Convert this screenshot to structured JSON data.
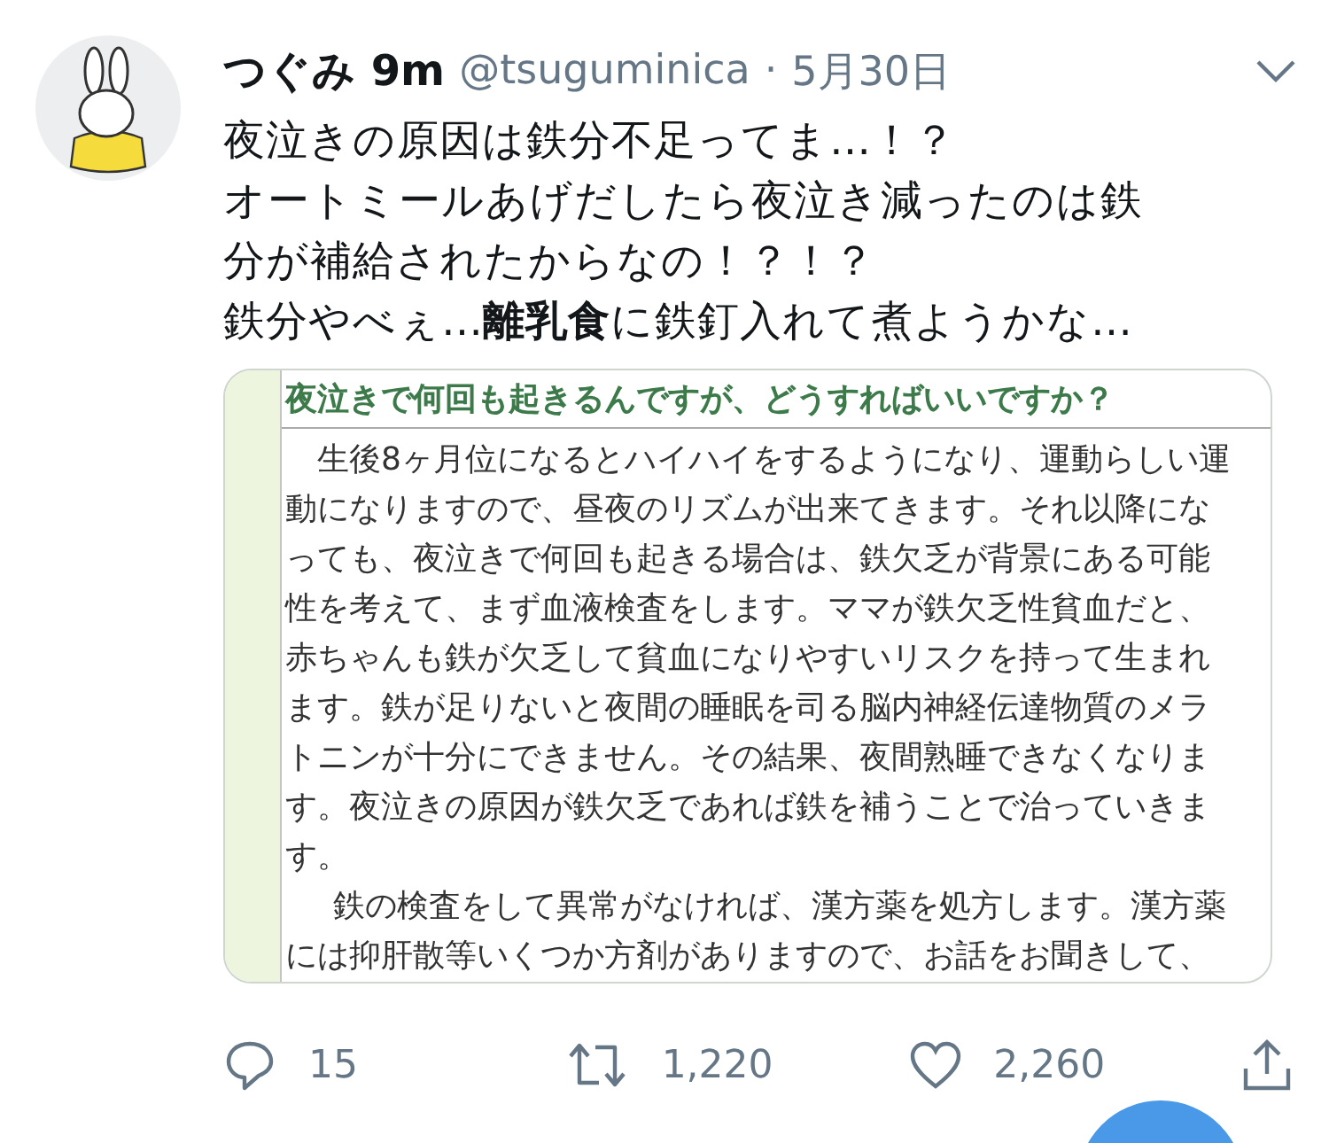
{
  "tweet": {
    "display_name": "つぐみ 9m",
    "handle": "@tsuguminica",
    "separator": "·",
    "date": "5月30日",
    "text": [
      "夜泣きの原因は鉄分不足ってま…！？",
      "オートミールあげだしたら夜泣き減ったのは鉄分が補給されたからなの！？！？",
      "鉄分やべぇ…**離乳食**に鉄釘入れて煮ようかな…"
    ],
    "attachment": {
      "heading": "夜泣きで何回も起きるんですが、どうすればいいですか？",
      "paragraphs": [
        "生後8ヶ月位になるとハイハイをするようになり、運動らしい運動になりますので、昼夜のリズムが出来てきます。それ以降になっても、夜泣きで何回も起きる場合は、鉄欠乏が背景にある可能性を考えて、まず血液検査をします。ママが鉄欠乏性貧血だと、赤ちゃんも鉄が欠乏して貧血になりやすいリスクを持って生まれます。鉄が足りないと夜間の睡眠を司る脳内神経伝達物質のメラトニンが十分にできません。その結果、夜間熟睡できなくなります。夜泣きの原因が鉄欠乏であれば鉄を補うことで治っていきます。",
        "鉄の検査をして異常がなければ、漢方薬を処方します。漢方薬には抑肝散等いくつか方剤がありますので、お話をお聞きして、"
      ]
    },
    "actions": [
      {
        "kind": "reply",
        "count": "15"
      },
      {
        "kind": "retweet",
        "count": "1,220"
      },
      {
        "kind": "like",
        "count": "2,260"
      },
      {
        "kind": "share"
      }
    ]
  }
}
